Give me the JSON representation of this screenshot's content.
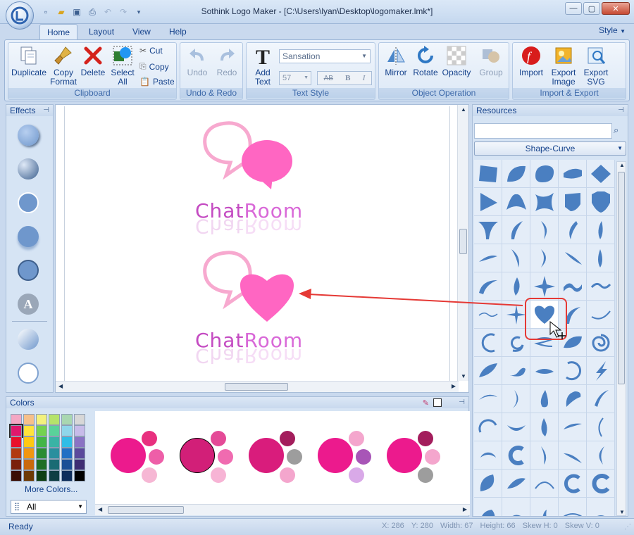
{
  "window": {
    "title": "Sothink Logo Maker - [C:\\Users\\lyan\\Desktop\\logomaker.lmk*]"
  },
  "menu": {
    "tabs": [
      "Home",
      "Layout",
      "View",
      "Help"
    ],
    "active_tab": "Home",
    "style_label": "Style"
  },
  "ribbon": {
    "clipboard": {
      "label": "Clipboard",
      "duplicate": "Duplicate",
      "copy_format_1": "Copy",
      "copy_format_2": "Format",
      "delete": "Delete",
      "select_all_1": "Select",
      "select_all_2": "All",
      "cut": "Cut",
      "copy": "Copy",
      "paste": "Paste"
    },
    "undo_redo": {
      "label": "Undo & Redo",
      "undo": "Undo",
      "redo": "Redo"
    },
    "text_style": {
      "label": "Text Style",
      "add_text_1": "Add",
      "add_text_2": "Text",
      "font": "Sansation",
      "size": "57",
      "ab": "AB",
      "bold": "B",
      "italic": "I"
    },
    "object_operation": {
      "label": "Object Operation",
      "mirror": "Mirror",
      "rotate": "Rotate",
      "opacity": "Opacity",
      "group": "Group"
    },
    "import_export": {
      "label": "Import & Export",
      "import": "Import",
      "export_image_1": "Export",
      "export_image_2": "Image",
      "export_svg_1": "Export",
      "export_svg_2": "SVG"
    }
  },
  "effects_panel": {
    "title": "Effects",
    "item_count": 8
  },
  "canvas": {
    "logos": [
      {
        "text_a": "Chat",
        "text_b": "Room",
        "bubble": "speech"
      },
      {
        "text_a": "Chat",
        "text_b": "Room",
        "bubble": "heart"
      }
    ]
  },
  "resources_panel": {
    "title": "Resources",
    "search_value": "",
    "category": "Shape-Curve",
    "selected_shape": "heart"
  },
  "colors_panel": {
    "title": "Colors",
    "more_colors": "More Colors...",
    "filter": "All",
    "swatches": [
      "#f4a7c4",
      "#f6c08a",
      "#f3f17d",
      "#b5e36b",
      "#a9d7b0",
      "#d7d7d7",
      "#e0186c",
      "#ffe33c",
      "#74d250",
      "#5ad29a",
      "#8fd6ea",
      "#c7bbe9",
      "#e8102a",
      "#ffc812",
      "#43b547",
      "#3ab3a5",
      "#2fbde6",
      "#8a73c4",
      "#b13a10",
      "#f19611",
      "#2b8c33",
      "#2a8f9e",
      "#2170c4",
      "#5b4a9c",
      "#7a1f0b",
      "#c9690d",
      "#1e6e24",
      "#1a6b74",
      "#1b4f96",
      "#3e2d73",
      "#3a0e05",
      "#6e3a05",
      "#0f4013",
      "#0f3d43",
      "#0e2e5c",
      "#000000"
    ],
    "schemes": [
      {
        "main": "#ec1a8d",
        "dots": [
          "#e8307f",
          "#ee5ea8",
          "#f6b7d4"
        ]
      },
      {
        "main": "#d21f78",
        "dots": [
          "#e44a97",
          "#f06bb0",
          "#f7b4d5"
        ],
        "selected": true
      },
      {
        "main": "#d91c7c",
        "dots": [
          "#a31d5c",
          "#9d9d9d",
          "#f4a6cd"
        ]
      },
      {
        "main": "#ec1a8d",
        "dots": [
          "#f4a6cd",
          "#a855b7",
          "#d9a9e8"
        ]
      },
      {
        "main": "#ec1a8d",
        "dots": [
          "#a31d5c",
          "#f4a6cd",
          "#9d9d9d"
        ]
      }
    ]
  },
  "statusbar": {
    "ready": "Ready",
    "x": "X: 286",
    "y": "Y: 280",
    "width": "Width: 67",
    "height": "Height: 66",
    "skew_h": "Skew H: 0",
    "skew_v": "Skew V: 0"
  },
  "colors": {
    "accent": "#15428b",
    "shape_blue": "#4a7fc1",
    "logo_pink": "#ff5fb8",
    "arrow_red": "#e53935"
  }
}
